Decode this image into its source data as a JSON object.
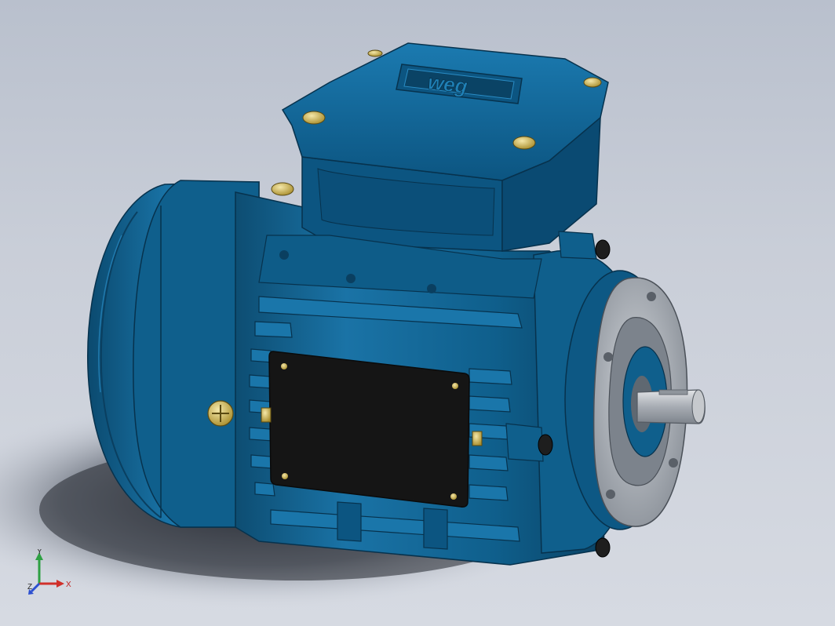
{
  "model": {
    "brand_logo_text": "weg"
  },
  "triad": {
    "x_label": "X",
    "y_label": "Y",
    "z_label": "Z"
  },
  "colors": {
    "background_top": "#b9c0cd",
    "background_bottom": "#d6dae2",
    "motor_blue": "#0f5f8c",
    "motor_blue_dark": "#0a3f60",
    "motor_blue_light": "#1f7bb0",
    "nameplate": "#151515",
    "screw_brass": "#d9c26a",
    "flange_grey": "#9aa0a8",
    "shaft_grey": "#b8bcc2",
    "axis_x": "#d0302a",
    "axis_y": "#2ea043",
    "axis_z": "#2c4fd0"
  }
}
